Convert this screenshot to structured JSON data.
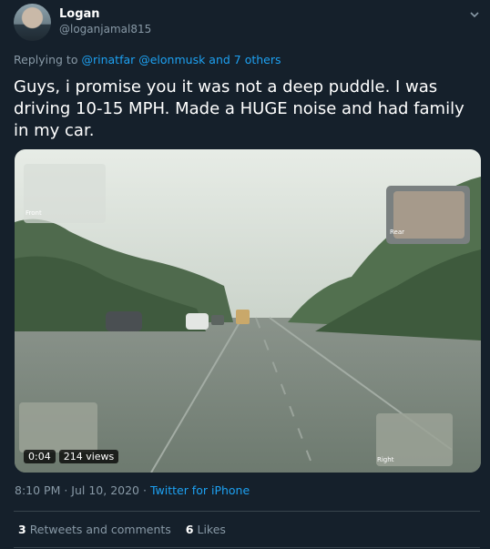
{
  "author": {
    "display_name": "Logan",
    "handle": "@loganjamal815"
  },
  "reply": {
    "prefix": "Replying to",
    "mentions": "@rinatfar @elonmusk and 7 others"
  },
  "tweet": {
    "text": "Guys, i promise you it was not a deep puddle. I was driving 10-15 MPH. Made a HUGE noise and had family in my car."
  },
  "video": {
    "timestamp": "0:04",
    "views": "214 views",
    "cam_labels": {
      "front": "Front",
      "rear": "Rear",
      "right": "Right"
    }
  },
  "meta": {
    "time": "8:10 PM · Jul 10, 2020 · ",
    "source": "Twitter for iPhone"
  },
  "stats": {
    "retweets_count": "3",
    "retweets_label": "Retweets and comments",
    "likes_count": "6",
    "likes_label": "Likes"
  },
  "colors": {
    "background": "#15202b",
    "link": "#1da1f2",
    "muted": "#8899a6"
  }
}
